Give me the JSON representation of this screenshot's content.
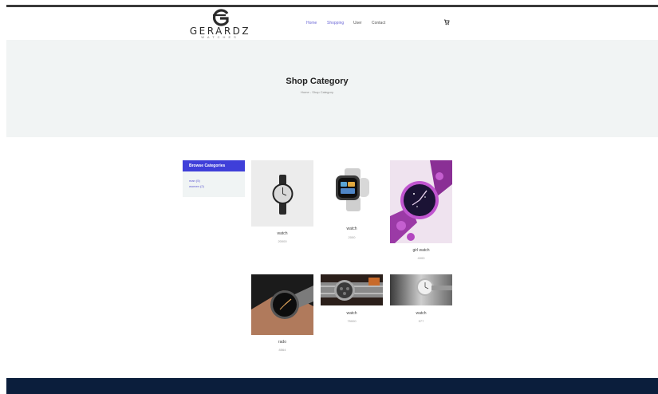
{
  "brand": {
    "name": "GERARDZ",
    "tagline": "WATCHES"
  },
  "nav": [
    {
      "label": "Home"
    },
    {
      "label": "Shopping"
    },
    {
      "label": "User"
    },
    {
      "label": "Contact"
    }
  ],
  "hero": {
    "title": "Shop Category",
    "breadcrumb": "Home - Shop Category"
  },
  "sidebar": {
    "title": "Browse Categories",
    "items": [
      {
        "label": "man (5)"
      },
      {
        "label": "women (2)"
      }
    ]
  },
  "products": [
    {
      "name": "watch",
      "price": "20000"
    },
    {
      "name": "watch",
      "price": "2000"
    },
    {
      "name": "girl watch",
      "price": "4000"
    },
    {
      "name": "rado",
      "price": "8564"
    },
    {
      "name": "watch",
      "price": "75000"
    },
    {
      "name": "watch",
      "price": "977"
    }
  ],
  "colors": {
    "accent": "#3f3fd9",
    "hero_bg": "#f1f4f4",
    "footer_bg": "#0b1e3c",
    "nav_link": "#6b67d6"
  }
}
